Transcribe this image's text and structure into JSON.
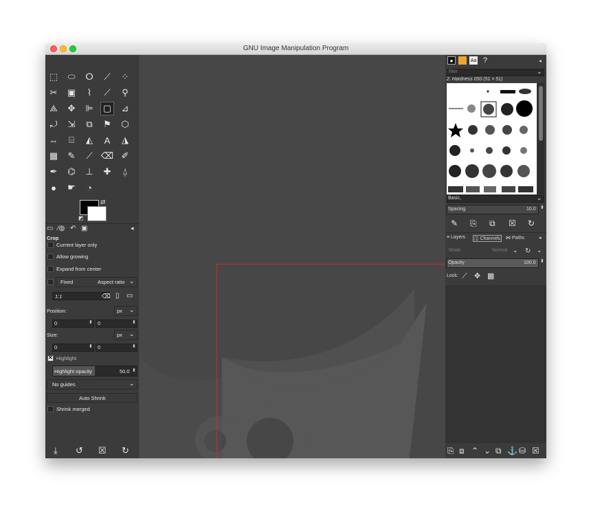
{
  "window": {
    "title": "GNU Image Manipulation Program"
  },
  "toolbox": {
    "tools": [
      {
        "name": "rect-select-icon",
        "glyph": "⬚"
      },
      {
        "name": "ellipse-select-icon",
        "glyph": "⬭"
      },
      {
        "name": "free-select-icon",
        "glyph": "ⵔ"
      },
      {
        "name": "fuzzy-select-icon",
        "glyph": "⟋"
      },
      {
        "name": "color-select-icon",
        "glyph": "⁘"
      },
      {
        "name": "scissors-icon",
        "glyph": "✂"
      },
      {
        "name": "foreground-select-icon",
        "glyph": "▣"
      },
      {
        "name": "paths-icon",
        "glyph": "⌇"
      },
      {
        "name": "color-picker-icon",
        "glyph": "⟋"
      },
      {
        "name": "zoom-icon",
        "glyph": "⚲"
      },
      {
        "name": "measure-icon",
        "glyph": "⟁"
      },
      {
        "name": "move-icon",
        "glyph": "✥"
      },
      {
        "name": "align-icon",
        "glyph": "⊫"
      },
      {
        "name": "crop-icon",
        "glyph": "▢"
      },
      {
        "name": "unified-transform-icon",
        "glyph": "⊿"
      },
      {
        "name": "rotate-icon",
        "glyph": "⤾"
      },
      {
        "name": "scale-icon",
        "glyph": "⇲"
      },
      {
        "name": "shear-icon",
        "glyph": "⧉"
      },
      {
        "name": "warp-icon",
        "glyph": "⚑"
      },
      {
        "name": "perspective-icon",
        "glyph": "⬡"
      },
      {
        "name": "flip-icon",
        "glyph": "⇔"
      },
      {
        "name": "cage-icon",
        "glyph": "⌸"
      },
      {
        "name": "bucket-fill-icon",
        "glyph": "◭"
      },
      {
        "name": "text-icon",
        "glyph": "A"
      },
      {
        "name": "gradient-icon",
        "glyph": "◮"
      },
      {
        "name": "pattern-icon",
        "glyph": "▦"
      },
      {
        "name": "pencil-icon",
        "glyph": "✎"
      },
      {
        "name": "paintbrush-icon",
        "glyph": "⟋"
      },
      {
        "name": "eraser-icon",
        "glyph": "⌫"
      },
      {
        "name": "airbrush-icon",
        "glyph": "✐"
      },
      {
        "name": "ink-icon",
        "glyph": "✒"
      },
      {
        "name": "mypaint-icon",
        "glyph": "⌬"
      },
      {
        "name": "clone-icon",
        "glyph": "⊥"
      },
      {
        "name": "heal-icon",
        "glyph": "✚"
      },
      {
        "name": "perspective-clone-icon",
        "glyph": "⍙"
      },
      {
        "name": "blur-icon",
        "glyph": "●"
      },
      {
        "name": "smudge-icon",
        "glyph": "☛"
      },
      {
        "name": "dodge-burn-icon",
        "glyph": "◔"
      }
    ]
  },
  "tool_options": {
    "title": "Crop",
    "current_layer_only": "Current layer only",
    "allow_growing": "Allow growing",
    "expand_from_center": "Expand from center",
    "fixed": "Fixed",
    "aspect_ratio": "Aspect ratio",
    "ratio_value": "1:1",
    "position_label": "Position:",
    "position_unit": "px",
    "position_x": "0",
    "position_y": "0",
    "size_label": "Size:",
    "size_unit": "px",
    "size_w": "0",
    "size_h": "0",
    "highlight": "Highlight",
    "highlight_opacity_label": "Highlight opacity",
    "highlight_opacity_value": "50.0",
    "highlight_opacity_fraction": 0.5,
    "guides": "No guides",
    "auto_shrink": "Auto Shrink",
    "shrink_merged": "Shrink merged"
  },
  "brushes": {
    "filter_placeholder": "filter",
    "current_brush": "2. Hardness 050 (51 × 51)",
    "tag_value": "Basic,",
    "spacing_label": "Spacing",
    "spacing_value": "10.0"
  },
  "layers": {
    "tabs": [
      "Layers",
      "Channels",
      "Paths"
    ],
    "mode_label": "Mode",
    "mode_value": "Normal",
    "opacity_label": "Opacity",
    "opacity_value": "100.0",
    "lock_label": "Lock:"
  },
  "colors": {
    "crop_border": "#d42a1e",
    "foreground": "#000000",
    "background": "#ffffff"
  }
}
